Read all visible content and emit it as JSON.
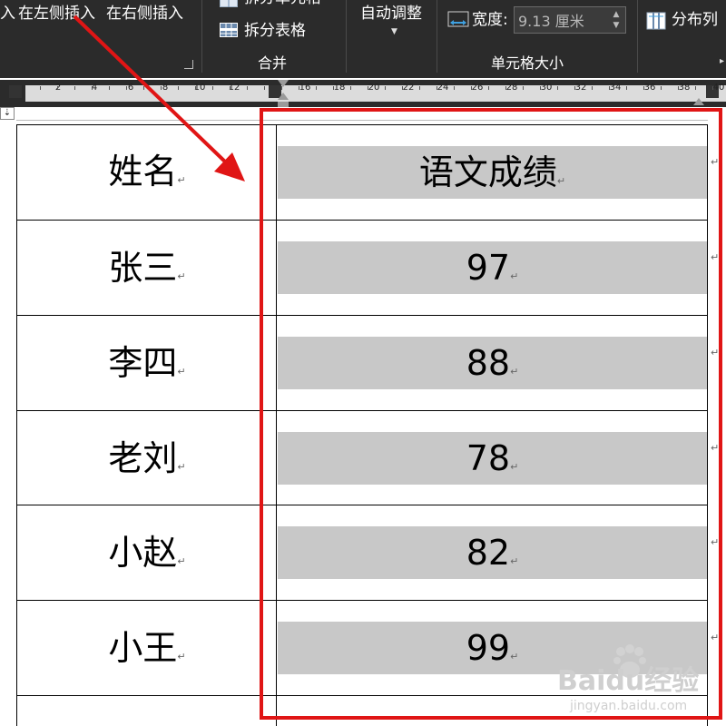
{
  "ribbon": {
    "row1": {
      "insert_partial": "入",
      "insert_left": "在左侧插入",
      "insert_right": "在右侧插入",
      "split_cells": "拆分单元格",
      "auto_fit": "自动调整",
      "width_label": "宽度:",
      "width_value": "9.13 厘米",
      "distribute_cols": "分布列"
    },
    "row2": {
      "split_table": "拆分表格"
    },
    "groups": {
      "merge": "合并",
      "cell_size": "单元格大小"
    },
    "icons": {
      "auto_fit_dropdown": "caret-down-icon",
      "width_icon": "column-width-icon",
      "distribute_icon": "distribute-columns-icon",
      "split_table_icon": "split-table-icon",
      "split_cells_icon": "split-cells-icon"
    }
  },
  "ruler": {
    "numbers": [
      "2",
      "4",
      "6",
      "8",
      "10",
      "12",
      "16",
      "18",
      "20",
      "22",
      "24",
      "26",
      "28",
      "30",
      "32",
      "34",
      "36",
      "38",
      "40"
    ]
  },
  "table": {
    "header": {
      "name": "姓名",
      "score": "语文成绩"
    },
    "rows": [
      {
        "name": "张三",
        "score": "97"
      },
      {
        "name": "李四",
        "score": "88"
      },
      {
        "name": "老刘",
        "score": "78"
      },
      {
        "name": "小赵",
        "score": "82"
      },
      {
        "name": "小王",
        "score": "99"
      }
    ],
    "paragraph_mark": "↵"
  },
  "watermark": {
    "brand": "Baidu经验",
    "url": "jingyan.baidu.com"
  },
  "colors": {
    "ribbon_bg": "#2b2b2b",
    "highlight_red": "#e01515",
    "cell_shading": "#c8c8c8"
  }
}
